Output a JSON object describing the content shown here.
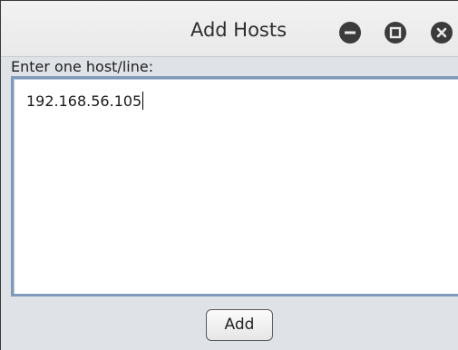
{
  "window": {
    "title": "Add Hosts",
    "controls": {
      "minimize_icon": "minimize-icon",
      "maximize_icon": "maximize-icon",
      "close_icon": "close-icon"
    }
  },
  "form": {
    "prompt_label": "Enter one host/line:",
    "hosts_value": "192.168.56.105",
    "add_label": "Add"
  },
  "colors": {
    "textarea_border": "#7f9ab8",
    "dialog_bg": "#dfe2e7",
    "titlebar_bg": "#ececec",
    "wm_button": "#3b3b3b"
  }
}
